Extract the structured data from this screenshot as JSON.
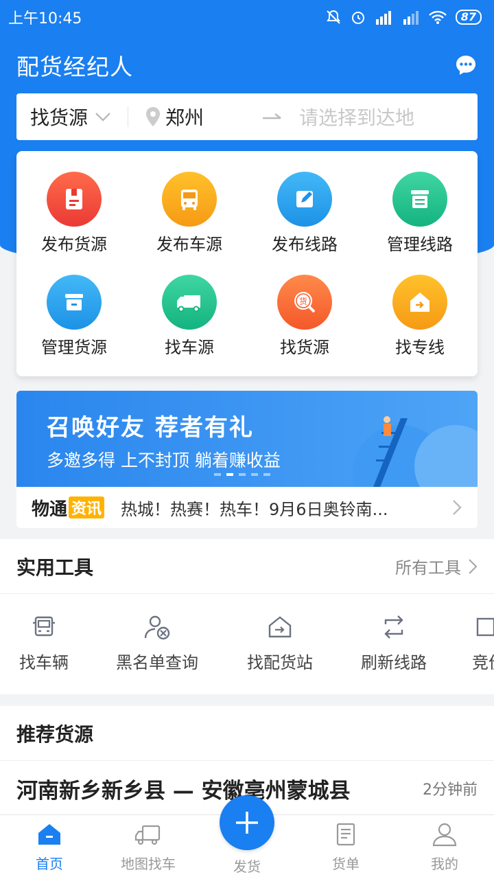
{
  "status": {
    "time": "上午10:45",
    "battery": "87"
  },
  "header": {
    "title": "配货经纪人",
    "chat_icon": "chat-bubble-icon"
  },
  "search": {
    "type_label": "找货源",
    "from": "郑州",
    "to_placeholder": "请选择到达地"
  },
  "menu": [
    {
      "label": "发布货源",
      "color": "#f2473a",
      "icon": "publish-cargo-icon"
    },
    {
      "label": "发布车源",
      "color": "#f7a21b",
      "icon": "publish-truck-icon"
    },
    {
      "label": "发布线路",
      "color": "#27a4ef",
      "icon": "publish-route-icon"
    },
    {
      "label": "管理线路",
      "color": "#1ec18d",
      "icon": "manage-route-icon"
    },
    {
      "label": "管理货源",
      "color": "#27a4ef",
      "icon": "manage-cargo-icon"
    },
    {
      "label": "找车源",
      "color": "#1ec18d",
      "icon": "find-truck-icon"
    },
    {
      "label": "找货源",
      "color": "#f86a2b",
      "icon": "find-cargo-icon"
    },
    {
      "label": "找专线",
      "color": "#f7a21b",
      "icon": "find-line-icon"
    }
  ],
  "banner": {
    "title": "召唤好友 荐者有礼",
    "subtitle": "多邀多得 上不封顶 躺着赚收益"
  },
  "news": {
    "logo_main": "物通",
    "logo_tag": "资讯",
    "text": "热城！热赛！热车！9月6日奥铃南..."
  },
  "tools": {
    "title": "实用工具",
    "all_label": "所有工具",
    "items": [
      {
        "label": "找车辆",
        "icon": "truck-front-icon"
      },
      {
        "label": "黑名单查询",
        "icon": "user-block-icon"
      },
      {
        "label": "找配货站",
        "icon": "station-icon"
      },
      {
        "label": "刷新线路",
        "icon": "refresh-icon"
      },
      {
        "label": "竞价",
        "icon": "bid-icon"
      }
    ]
  },
  "recommend": {
    "title": "推荐货源",
    "route": "河南新乡新乡县 — 安徽亳州蒙城县",
    "time": "2分钟前"
  },
  "tabs": [
    {
      "label": "首页",
      "icon": "home-icon",
      "active": true
    },
    {
      "label": "地图找车",
      "icon": "map-truck-icon",
      "active": false
    },
    {
      "label": "发货",
      "icon": "plus-icon",
      "active": false
    },
    {
      "label": "货单",
      "icon": "order-list-icon",
      "active": false
    },
    {
      "label": "我的",
      "icon": "profile-icon",
      "active": false
    }
  ],
  "colors": {
    "primary": "#1a7ff0"
  }
}
